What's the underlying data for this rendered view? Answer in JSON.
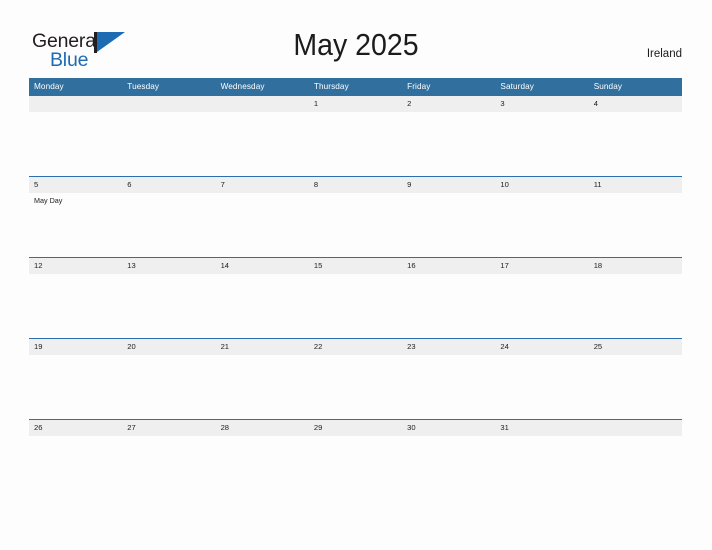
{
  "brand": {
    "name_part1": "General",
    "name_part2": "Blue",
    "flag_icon": "flag-triangle-icon",
    "accent_color": "#1d6cb3"
  },
  "header": {
    "title": "May 2025",
    "region": "Ireland"
  },
  "calendar": {
    "month": "May",
    "year": "2025",
    "header_bg": "#31709e",
    "date_band_bg": "#efefef",
    "week_divider_color": "#2a6fae",
    "weekdays": [
      "Monday",
      "Tuesday",
      "Wednesday",
      "Thursday",
      "Friday",
      "Saturday",
      "Sunday"
    ],
    "weeks": [
      {
        "days": [
          {
            "date": "",
            "events": []
          },
          {
            "date": "",
            "events": []
          },
          {
            "date": "",
            "events": []
          },
          {
            "date": "1",
            "events": []
          },
          {
            "date": "2",
            "events": []
          },
          {
            "date": "3",
            "events": []
          },
          {
            "date": "4",
            "events": []
          }
        ]
      },
      {
        "days": [
          {
            "date": "5",
            "events": [
              "May Day"
            ]
          },
          {
            "date": "6",
            "events": []
          },
          {
            "date": "7",
            "events": []
          },
          {
            "date": "8",
            "events": []
          },
          {
            "date": "9",
            "events": []
          },
          {
            "date": "10",
            "events": []
          },
          {
            "date": "11",
            "events": []
          }
        ]
      },
      {
        "days": [
          {
            "date": "12",
            "events": []
          },
          {
            "date": "13",
            "events": []
          },
          {
            "date": "14",
            "events": []
          },
          {
            "date": "15",
            "events": []
          },
          {
            "date": "16",
            "events": []
          },
          {
            "date": "17",
            "events": []
          },
          {
            "date": "18",
            "events": []
          }
        ]
      },
      {
        "days": [
          {
            "date": "19",
            "events": []
          },
          {
            "date": "20",
            "events": []
          },
          {
            "date": "21",
            "events": []
          },
          {
            "date": "22",
            "events": []
          },
          {
            "date": "23",
            "events": []
          },
          {
            "date": "24",
            "events": []
          },
          {
            "date": "25",
            "events": []
          }
        ]
      },
      {
        "days": [
          {
            "date": "26",
            "events": []
          },
          {
            "date": "27",
            "events": []
          },
          {
            "date": "28",
            "events": []
          },
          {
            "date": "29",
            "events": []
          },
          {
            "date": "30",
            "events": []
          },
          {
            "date": "31",
            "events": []
          },
          {
            "date": "",
            "events": []
          }
        ]
      }
    ]
  }
}
